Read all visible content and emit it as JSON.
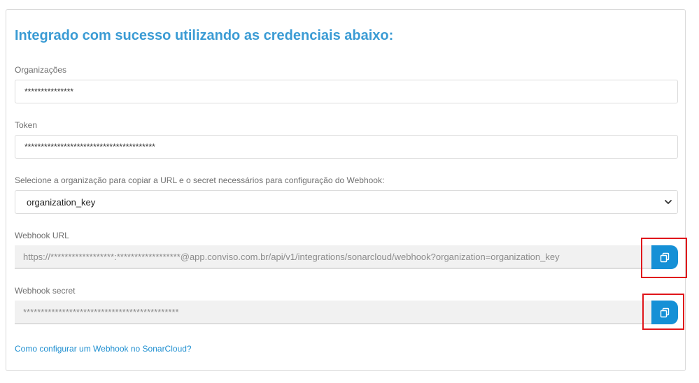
{
  "header": {
    "title": "Integrado com sucesso utilizando as credenciais abaixo:"
  },
  "organizations": {
    "label": "Organizações",
    "value": "***************"
  },
  "token": {
    "label": "Token",
    "value": "****************************************"
  },
  "org_select": {
    "label": "Selecione a organização para copiar a URL e o secret necessários para configuração do Webhook:",
    "selected": "organization_key"
  },
  "webhook_url": {
    "label": "Webhook URL",
    "value": "https://******************:******************@app.conviso.com.br/api/v1/integrations/sonarcloud/webhook?organization=organization_key"
  },
  "webhook_secret": {
    "label": "Webhook secret",
    "value": "********************************************"
  },
  "help_link": "Como configurar um Webhook no SonarCloud?",
  "colors": {
    "accent": "#3a9bd4",
    "button": "#1590d6",
    "highlight": "#e0161b"
  },
  "icons": {
    "copy": "copy-icon",
    "dropdown": "chevron-down-icon"
  }
}
